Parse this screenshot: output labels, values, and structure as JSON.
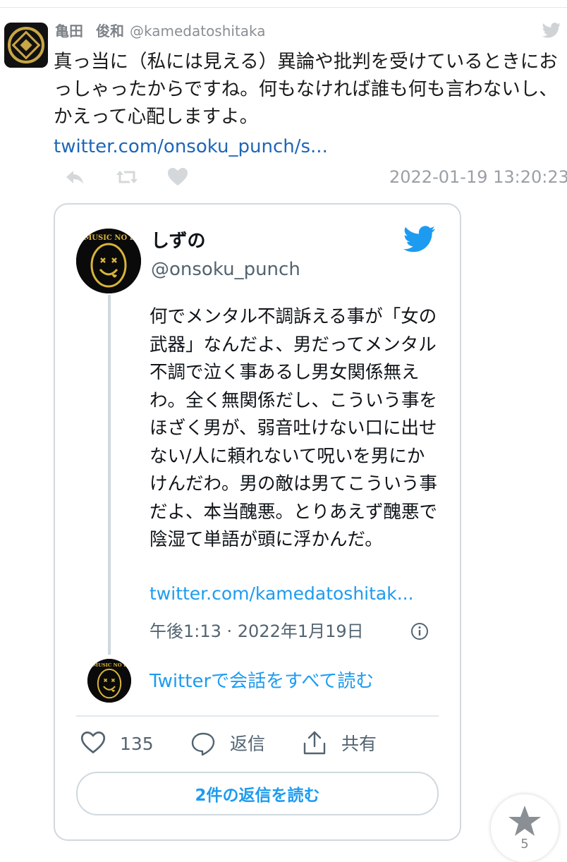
{
  "tweet": {
    "display_name": "亀田　俊和",
    "display_name_first": "亀田",
    "display_name_last": "俊和",
    "handle": "@kamedatoshitaka",
    "text": "真っ当に（私には見える）異論や批判を受けているときにおっしゃったからですね。何もなければ誰も何も言わないし、かえって心配しますよ。",
    "link": "twitter.com/onsoku_punch/s...",
    "timestamp": "2022-01-19 13:20:23"
  },
  "embed": {
    "display_name": "しずの",
    "handle": "@onsoku_punch",
    "avatar_text": "NO MUSIC NO LIFE",
    "text": "何でメンタル不調訴える事が「女の武器」なんだよ、男だってメンタル不調で泣く事あるし男女関係無えわ。全く無関係だし、こういう事をほざく男が、弱音吐けない口に出せない/人に頼れないて呪いを男にかけんだわ。男の敵は男てこういう事だよ、本当醜悪。とりあえず醜悪で陰湿て単語が頭に浮かんだ。",
    "link": "twitter.com/kamedatoshitak...",
    "time": "午後1:13 · 2022年1月19日",
    "read_conversation": "Twitterで会話をすべて読む",
    "like_count": "135",
    "reply_label": "返信",
    "share_label": "共有",
    "read_replies_button": "2件の返信を読む"
  },
  "favorite": {
    "count": "5"
  },
  "colors": {
    "link": "#1d66b8",
    "twitter_blue": "#1d9bf0",
    "gold": "#d8b43a"
  },
  "icons": [
    "kamon-avatar-icon",
    "twitter-bird-icon",
    "reply-icon",
    "retweet-icon",
    "like-icon",
    "info-icon",
    "heart-icon",
    "comment-icon",
    "share-icon",
    "star-icon"
  ]
}
